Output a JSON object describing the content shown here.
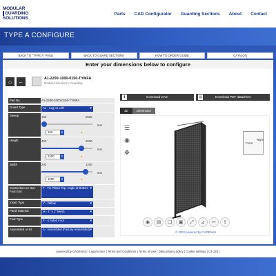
{
  "brand": {
    "line1": "MODULAR",
    "line2": "GUARDING",
    "line3": "SOLUTIONS"
  },
  "nav": {
    "items": [
      "Parts",
      "CAD Configurator",
      "Guarding Sections",
      "About",
      "Contact"
    ]
  },
  "banner": {
    "title": "TYPE A CONFIGURE"
  },
  "top_buttons": [
    "BACK TO \"TYPE A\" PAGE",
    "BACK TO GUARD SECTIONS",
    "HOW TO ORDER GUIDE",
    "CATALOG"
  ],
  "headline": "Enter your dimensions below to configure",
  "part": {
    "number": "A1-2200-1000-0150-TYMFA",
    "breadcrumb": "Modular Solutions  >  Guarding"
  },
  "downloads": {
    "cad": "Download CAD",
    "pdf": "Download PDF datasheet"
  },
  "view_tabs": [
    "3D",
    "Dimension"
  ],
  "form": {
    "part_no_label": "Part No.",
    "part_no_value": "A1-2200-1000-0150-TYMFA",
    "guard_type_label": "Guard Type",
    "guard_type_value": "A1 - Leg on Left",
    "sweep_label": "Sweep",
    "sweep_min": "150",
    "sweep_max": "2500",
    "sweep_value": "150",
    "height_label": "Height",
    "height_min": "400",
    "height_max": "2500",
    "height_value": "2200",
    "width_label": "Width",
    "width_min": "200",
    "width_max": "1200",
    "width_value": "1000",
    "conn_label": "Connection on Non-Foot End",
    "conn_value": "T - Tie Plates Top, Angle at Bottom",
    "insert_label": "Insert Type",
    "insert_value": "Y - Yellow",
    "panel_label": "Panel Material",
    "panel_value": "M - 1\" x 1\" Mesh",
    "foot_label": "Foot Type",
    "foot_value": "F - 4 Sided Foot",
    "assembled_label": "Assembled or Kit",
    "assembled_value": "A - Assembled (Factory Assembled)",
    "unit": "mm"
  },
  "cube": {
    "front": "Front",
    "right": "Right"
  },
  "copyright": "© 2023 powered by CADENAS",
  "footer": "powered by CADENAS  |  Legal notice  |  Terms and Conditions  |  Terms of Use  |  Data privacy policy  |  Cookie settings  |  C4-223  |"
}
